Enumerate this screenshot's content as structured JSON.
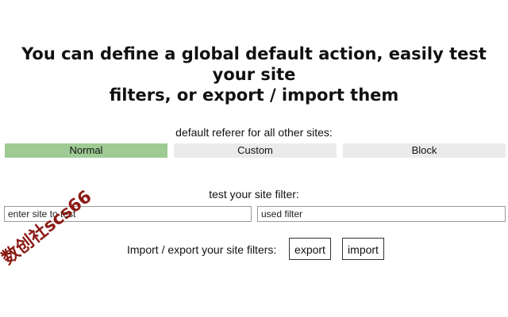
{
  "headline": {
    "line1": "You can define a global default action, easily test your site",
    "line2": "filters, or export / import them"
  },
  "referer": {
    "label": "default referer for all other sites:",
    "options": [
      {
        "label": "Normal",
        "selected": true
      },
      {
        "label": "Custom",
        "selected": false
      },
      {
        "label": "Block",
        "selected": false
      }
    ],
    "active_color": "#9ecb94",
    "inactive_color": "#ebebeb"
  },
  "test": {
    "label": "test your site filter:",
    "site_placeholder": "enter site to test",
    "filter_placeholder": "used filter"
  },
  "io": {
    "label": "Import / export your site filters:",
    "export_label": "export",
    "import_label": "import"
  },
  "watermark": {
    "text": "数创社scs66",
    "color": "#8b1a14"
  }
}
